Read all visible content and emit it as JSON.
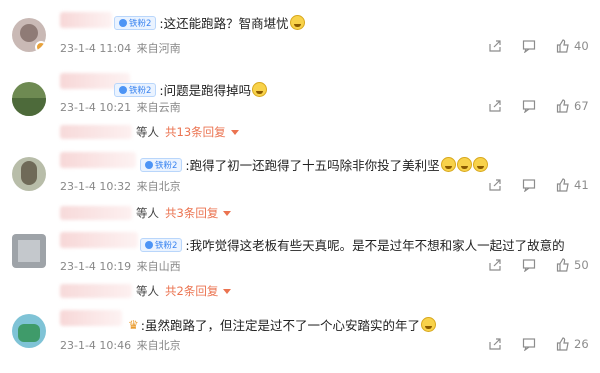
{
  "comments": [
    {
      "badge": "铁粉2",
      "text": ":这还能跑路？智商堪忧",
      "time": "23-1-4 11:04",
      "location": "来自河南",
      "likes": "40",
      "avatar_color": "#c9b9b5",
      "emoji_count": 1
    },
    {
      "badge": "铁粉2",
      "text": ":问题是跑得掉吗",
      "time": "23-1-4 10:21",
      "location": "来自云南",
      "likes": "67",
      "avatar_color": "#6e8a52",
      "replies": {
        "prefix": "等人",
        "link": "共13条回复"
      },
      "emoji_count": 1
    },
    {
      "badge": "铁粉2",
      "text": ":跑得了初一还跑得了十五吗除非你投了美利坚",
      "time": "23-1-4 10:32",
      "location": "来自北京",
      "likes": "41",
      "avatar_color": "#b8bda9",
      "replies": {
        "prefix": "等人",
        "link": "共3条回复"
      },
      "emoji_count": 3
    },
    {
      "badge": "铁粉2",
      "text": ":我咋觉得这老板有些天真呢。是不是过年不想和家人一起过了故意的",
      "time": "23-1-4 10:19",
      "location": "来自山西",
      "likes": "50",
      "avatar_color": "#9ea3a8",
      "replies": {
        "prefix": "等人",
        "link": "共2条回复"
      },
      "emoji_count": 0
    },
    {
      "badge": "",
      "text": ":虽然跑路了，但注定是过不了一个心安踏实的年了",
      "time": "23-1-4 10:46",
      "location": "来自北京",
      "likes": "26",
      "avatar_color": "#7fc3d6",
      "emoji_count": 1
    }
  ],
  "colors": {
    "accent_link": "#eb7350",
    "badge_blue": "#3a84f0",
    "meta_gray": "#888888"
  },
  "icons": [
    "share-icon",
    "comment-icon",
    "thumbs-up-icon",
    "caret-down-icon"
  ]
}
